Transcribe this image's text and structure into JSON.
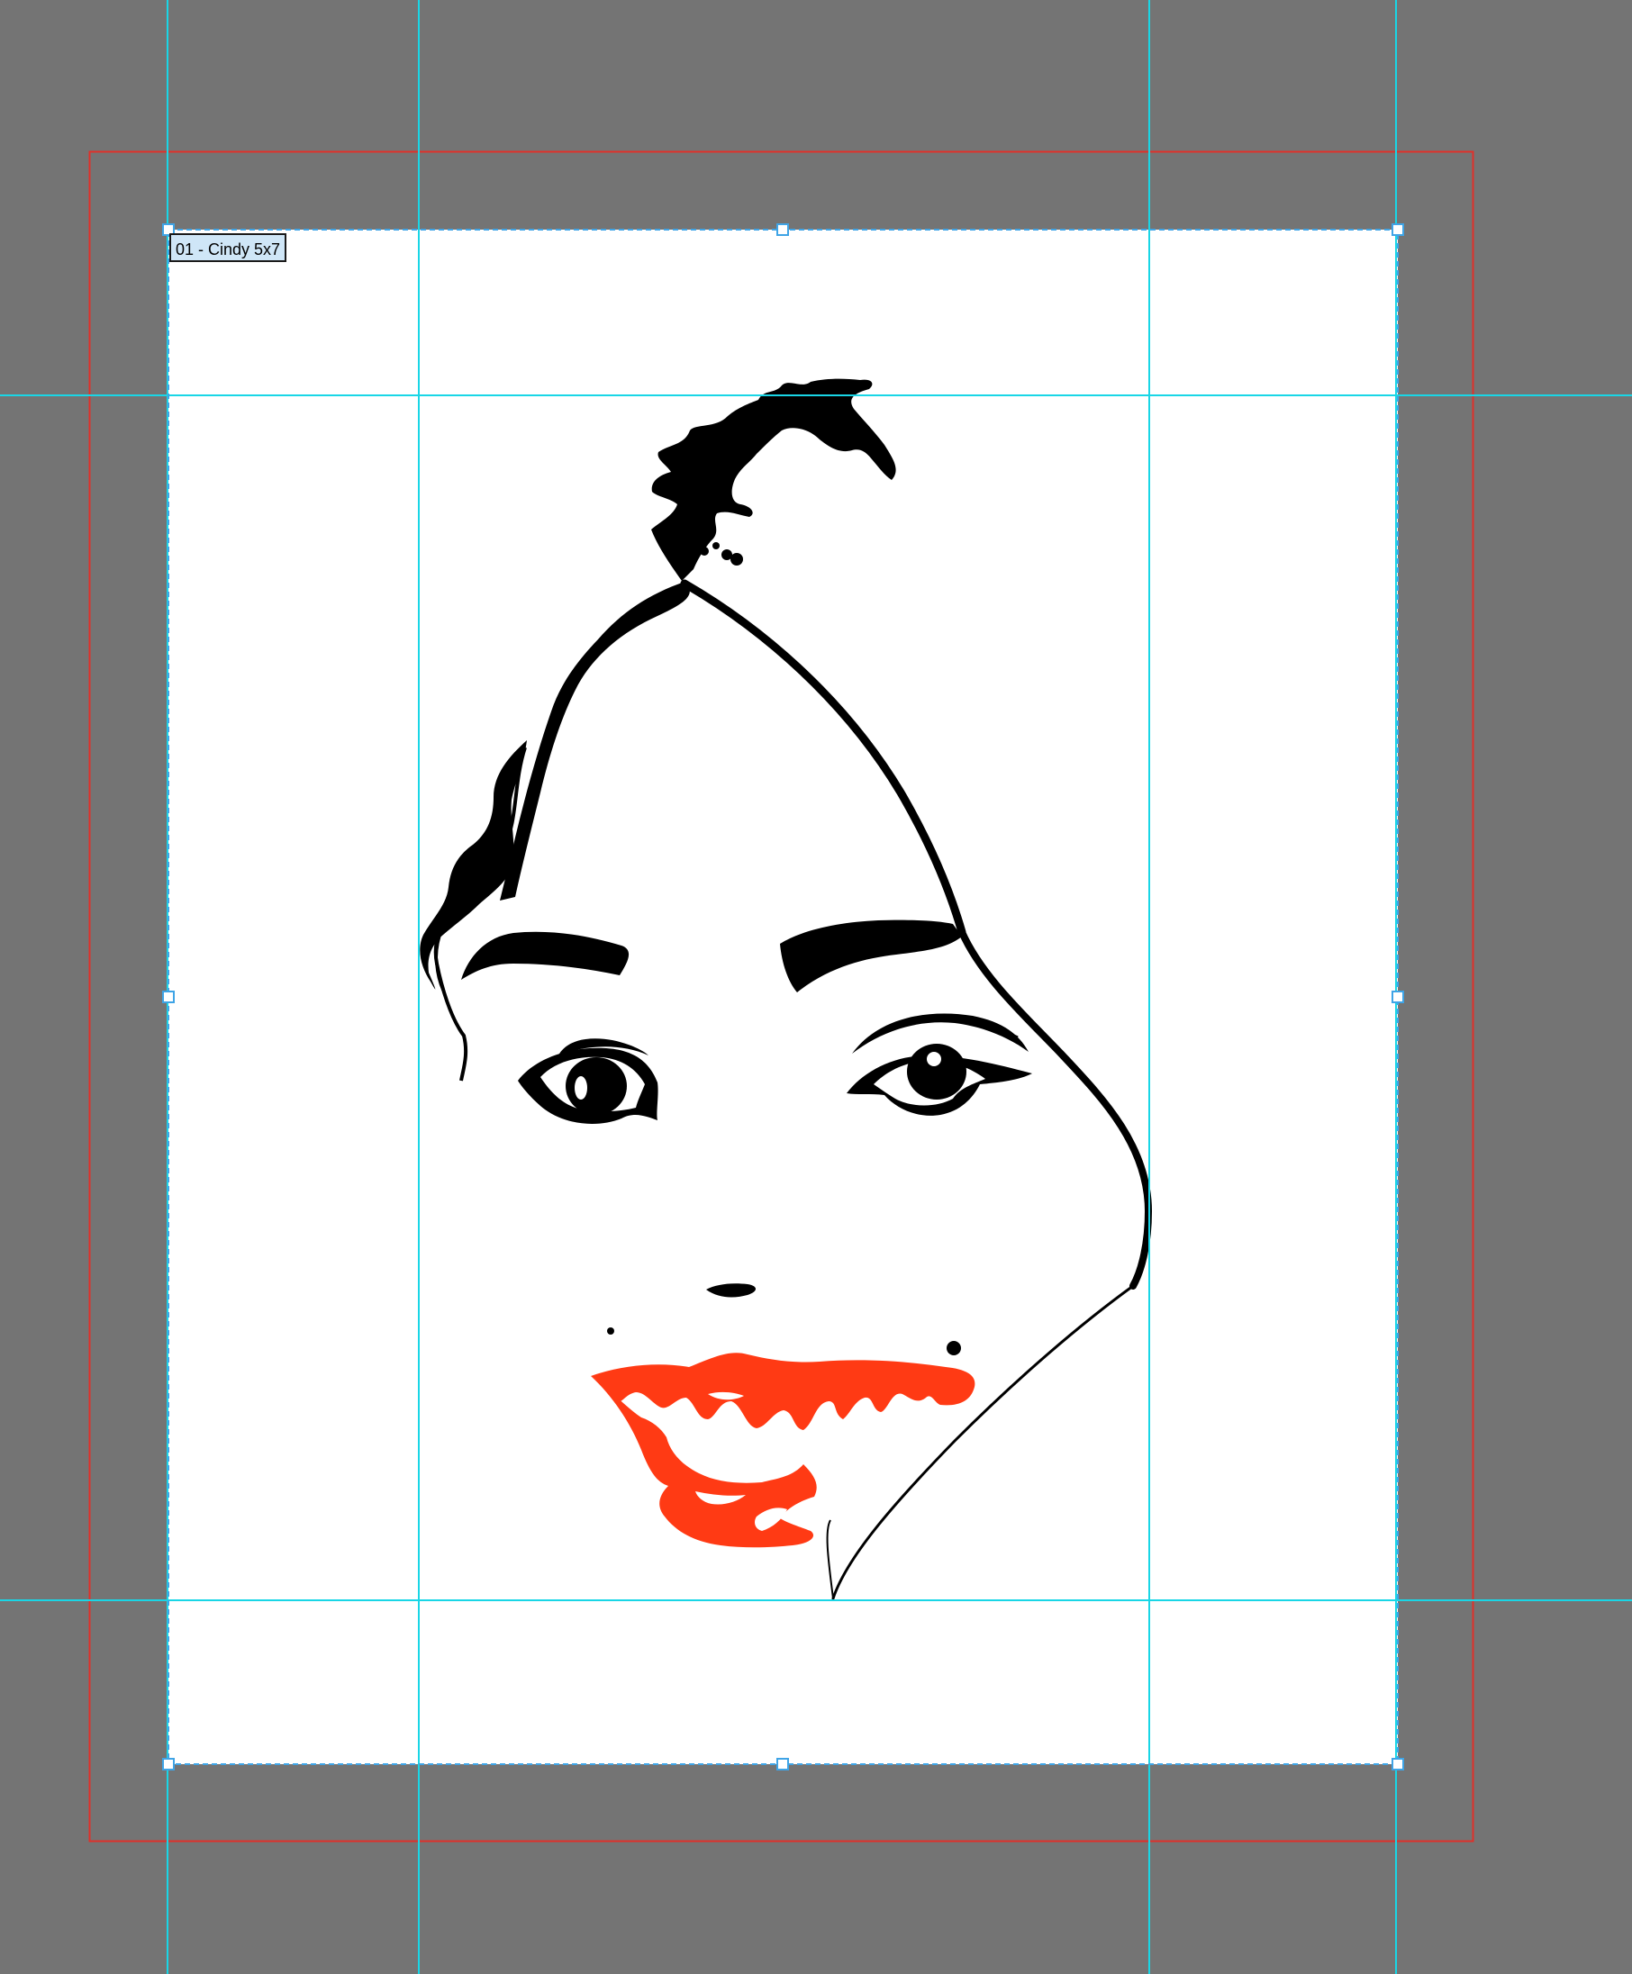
{
  "artboard": {
    "label": "01 - Cindy 5x7"
  },
  "colors": {
    "pasteboard": "#747474",
    "artboard_fill": "#ffffff",
    "bleed_guide": "#e0302a",
    "guide": "#19d6e6",
    "selection": "#3fa4e6",
    "lips": "#ff3a14",
    "ink": "#000000"
  },
  "icons": {
    "selection_handles": "square-handle-icon"
  }
}
